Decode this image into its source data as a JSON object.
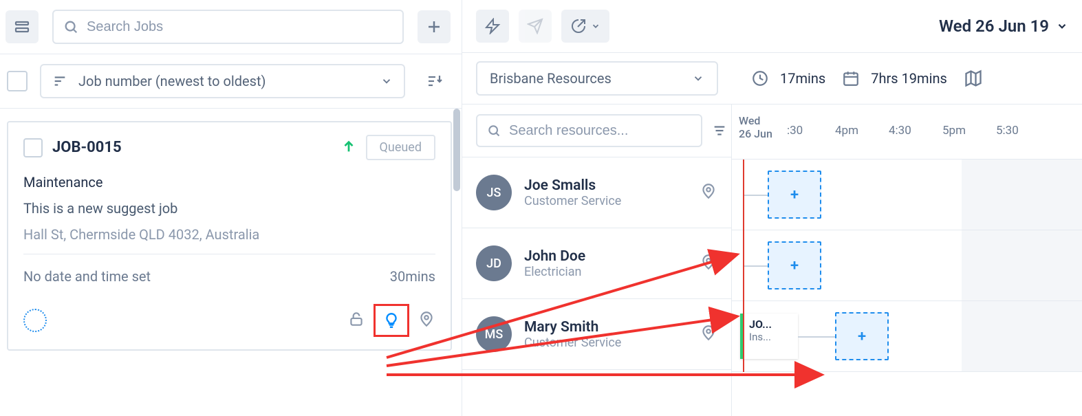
{
  "left": {
    "search": {
      "placeholder": "Search Jobs"
    },
    "sort": {
      "label": "Job number (newest to oldest)"
    },
    "job": {
      "id": "JOB-0015",
      "status": "Queued",
      "type": "Maintenance",
      "description": "This is a new suggest job",
      "address": "Hall St, Chermside QLD 4032, Australia",
      "time_label": "No date and time set",
      "duration": "30mins"
    }
  },
  "right": {
    "date": "Wed 26 Jun 19",
    "group": "Brisbane Resources",
    "stat_time": "17mins",
    "stat_duration": "7hrs 19mins",
    "resource_search": {
      "placeholder": "Search resources..."
    },
    "date_short_1": "Wed",
    "date_short_2": "26 Jun",
    "ticks": [
      ":30",
      "4pm",
      "4:30",
      "5pm",
      "5:30"
    ],
    "resources": [
      {
        "initials": "JS",
        "name": "Joe Smalls",
        "role": "Customer Service"
      },
      {
        "initials": "JD",
        "name": "John Doe",
        "role": "Electrician"
      },
      {
        "initials": "MS",
        "name": "Mary Smith",
        "role": "Customer Service"
      }
    ],
    "task": {
      "line1": "JO...",
      "line2": "Ins..."
    },
    "slot_plus": "+"
  }
}
